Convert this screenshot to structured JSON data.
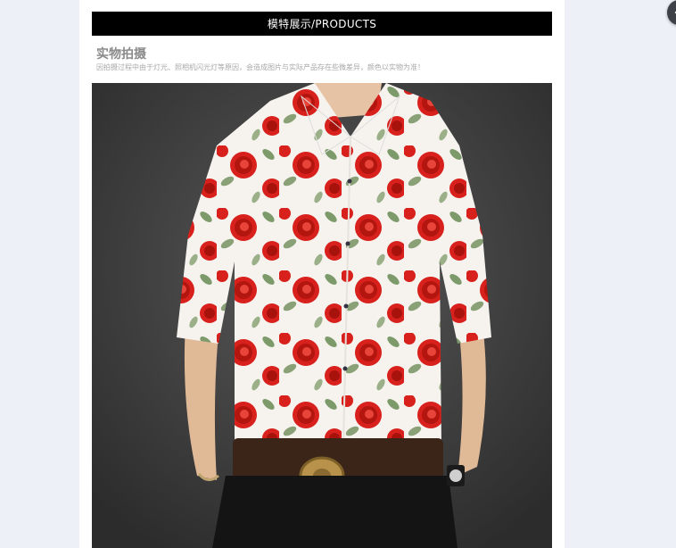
{
  "banner": {
    "title": "模特展示/PRODUCTS"
  },
  "section": {
    "title": "实物拍摄",
    "subtitle": "因拍摄过程中由于灯光、照相机闪光灯等原因，会造成图片与实际产品存在些微差异，颜色以实物为准！"
  },
  "photo": {
    "subject": "model-in-rose-print-shirt"
  },
  "colors": {
    "banner_bg": "#000000",
    "rose_red": "#d8201c",
    "leaf_green": "#7c9a6a",
    "backdrop": "#3c3c3c"
  },
  "side_button": {
    "icon": "chevron-icon"
  }
}
